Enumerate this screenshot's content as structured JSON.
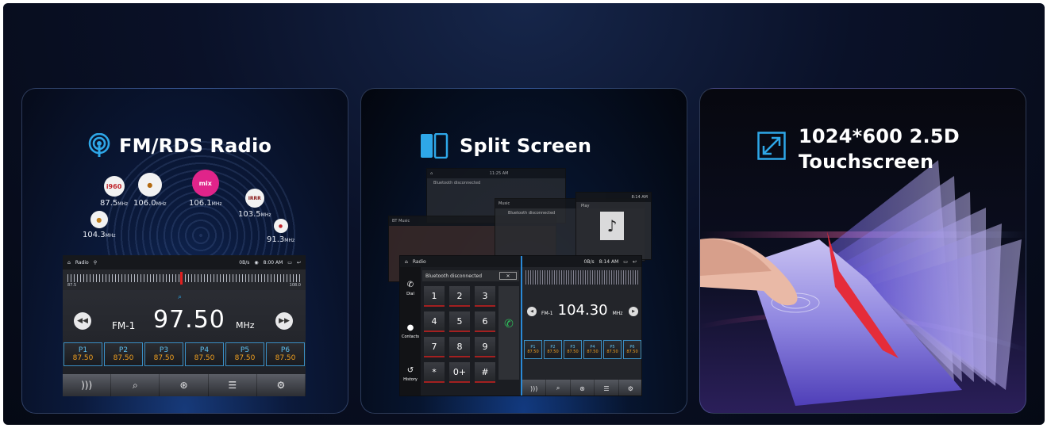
{
  "cards": [
    {
      "title": "FM/RDS Radio",
      "icon": "radio-signal-icon",
      "stations": [
        {
          "logo": "i960",
          "freq": "87.5",
          "unit": "MHz"
        },
        {
          "logo": "",
          "freq": "106.0",
          "unit": "MHz"
        },
        {
          "logo": "mix",
          "freq": "106.1",
          "unit": "MHz"
        },
        {
          "logo": "IRRR",
          "freq": "103.5",
          "unit": "MHz"
        },
        {
          "logo": "",
          "freq": "104.3",
          "unit": "MHz"
        },
        {
          "logo": "",
          "freq": "91.3",
          "unit": "MHz"
        }
      ],
      "radio_screen": {
        "app_label": "Radio",
        "status_right": "0B/s",
        "time": "8:00 AM",
        "scale_low": "87.5",
        "scale_high": "108.0",
        "band": "FM-1",
        "frequency": "97.50",
        "unit": "MHz",
        "presets": [
          {
            "name": "P1",
            "freq": "87.50"
          },
          {
            "name": "P2",
            "freq": "87.50"
          },
          {
            "name": "P3",
            "freq": "87.50"
          },
          {
            "name": "P4",
            "freq": "87.50"
          },
          {
            "name": "P5",
            "freq": "87.50"
          },
          {
            "name": "P6",
            "freq": "87.50"
          }
        ]
      }
    },
    {
      "title": "Split Screen",
      "icon": "split-screen-icon",
      "back_screens": {
        "time_a": "11:25 AM",
        "bt_text": "Bluetooth disconnected",
        "music_label": "BT Music",
        "time_c": "8:14 AM",
        "play_label": "Play",
        "music_tab": "Music"
      },
      "front_screen": {
        "app_label": "Radio",
        "status_right": "0B/s",
        "time": "8:14 AM",
        "bt_text": "Bluetooth disconnected",
        "side": [
          "Dial",
          "Contacts",
          "History"
        ],
        "keys": [
          "1",
          "2",
          "3",
          "4",
          "5",
          "6",
          "7",
          "8",
          "9",
          "*",
          "0+",
          "#"
        ],
        "band": "FM-1",
        "frequency": "104.30",
        "unit": "MHz",
        "presets": [
          {
            "name": "P1",
            "freq": "87.50"
          },
          {
            "name": "P2",
            "freq": "87.50"
          },
          {
            "name": "P3",
            "freq": "87.50"
          },
          {
            "name": "P4",
            "freq": "87.50"
          },
          {
            "name": "P5",
            "freq": "87.50"
          },
          {
            "name": "P6",
            "freq": "87.50"
          }
        ]
      }
    },
    {
      "title_line1": "1024*600 2.5D",
      "title_line2": "Touchscreen",
      "icon": "expand-diagonal-icon"
    }
  ],
  "colors": {
    "accent_blue": "#2ea7e8",
    "preset_freq": "#f0a020",
    "call_green": "#2ec05a",
    "needle_red": "#e02020"
  }
}
